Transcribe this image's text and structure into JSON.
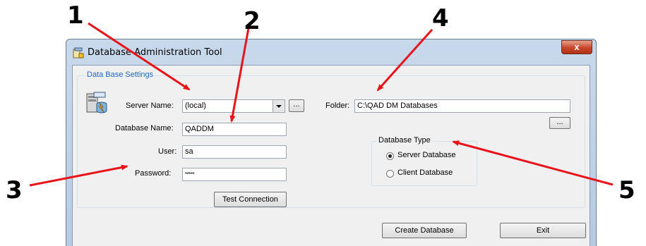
{
  "window": {
    "title": "Database Administration Tool",
    "close_glyph": "x"
  },
  "group": {
    "label": "Data Base Settings",
    "server_name_label": "Server Name:",
    "server_name_value": "(local)",
    "browse_button": "...",
    "database_name_label": "Database Name:",
    "database_name_value": "QADDM",
    "user_label": "User:",
    "user_value": "sa",
    "password_label": "Password:",
    "password_value": "*****",
    "test_connection_button": "Test Connection",
    "folder_label": "Folder:",
    "folder_value": "C:\\QAD DM Databases",
    "folder_browse_button": "...",
    "database_type": {
      "label": "Database Type",
      "options": [
        "Server Database",
        "Client Database"
      ],
      "selected": "Server Database"
    }
  },
  "footer": {
    "create_button": "Create Database",
    "exit_button": "Exit"
  },
  "callouts": [
    "1",
    "2",
    "3",
    "4",
    "5"
  ],
  "colors": {
    "arrow": "#e8141b",
    "group_label": "#1e68c9",
    "close_button": "#c7452b"
  },
  "icons": {
    "app": "database-tool-icon",
    "server": "server-database-icon"
  }
}
